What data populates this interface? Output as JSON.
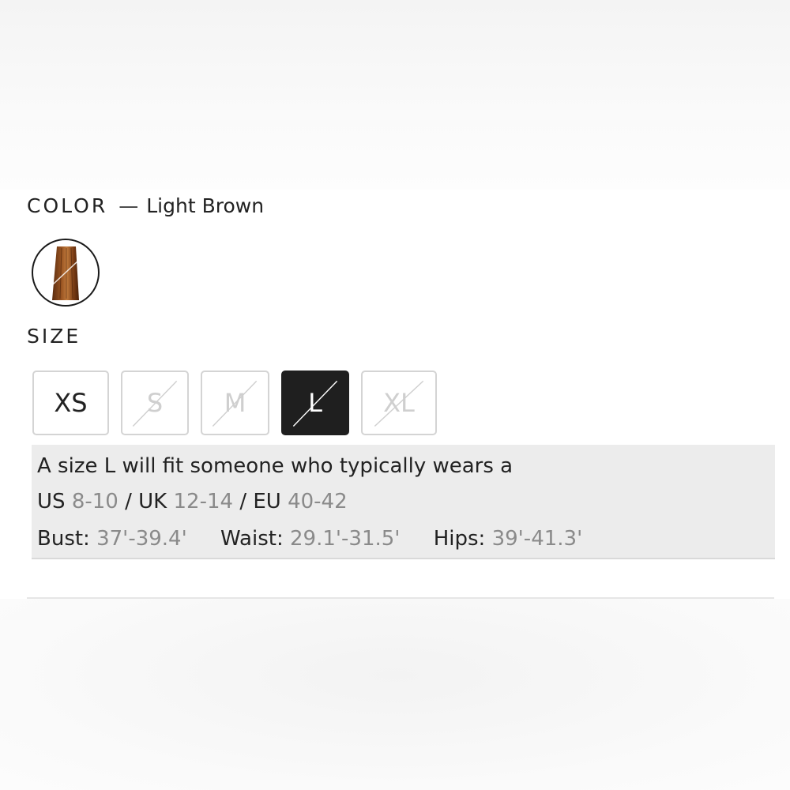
{
  "color": {
    "label": "COLOR",
    "separator": "—",
    "value": "Light Brown",
    "swatch_icon": "hair-swatch"
  },
  "size": {
    "label": "SIZE",
    "options": [
      {
        "label": "XS",
        "state": "available"
      },
      {
        "label": "S",
        "state": "unavailable"
      },
      {
        "label": "M",
        "state": "unavailable"
      },
      {
        "label": "L",
        "state": "selected"
      },
      {
        "label": "XL",
        "state": "unavailable"
      }
    ]
  },
  "fit": {
    "intro": "A size L will fit someone who typically wears a",
    "us_label": "US",
    "us_value": "8-10",
    "sep1": "/",
    "uk_label": "UK",
    "uk_value": "12-14",
    "sep2": "/",
    "eu_label": "EU",
    "eu_value": "40-42",
    "bust_label": "Bust:",
    "bust_value": "37'-39.4'",
    "waist_label": "Waist:",
    "waist_value": "29.1'-31.5'",
    "hips_label": "Hips:",
    "hips_value": "39'-41.3'"
  },
  "colors": {
    "selected_bg": "#1f1f1f",
    "unavailable_text": "#cfcfcf",
    "fit_bg": "#ececec",
    "muted_text": "#8a8a8a",
    "swatch_hair": "#8b4a1c"
  }
}
